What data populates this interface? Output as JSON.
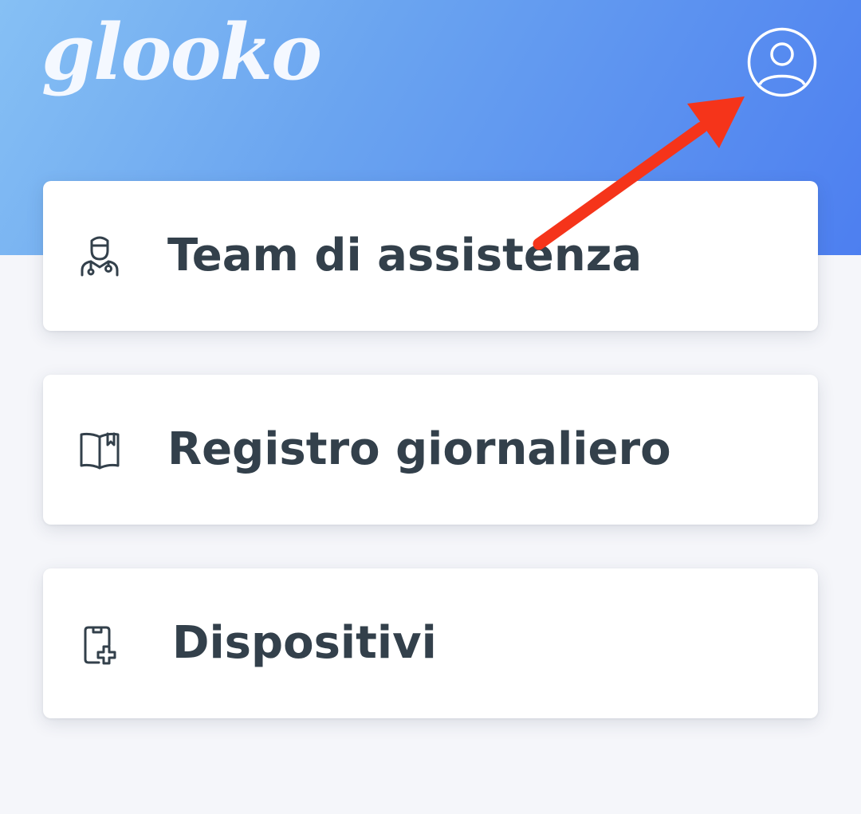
{
  "app": {
    "logo_text": "glooko"
  },
  "header": {
    "profile_icon": "user-circle-icon",
    "colors": {
      "gradient_start": "#86c0f4",
      "gradient_end": "#4d7ff0"
    }
  },
  "menu": {
    "items": [
      {
        "label": "Team di assistenza",
        "icon": "doctor-icon"
      },
      {
        "label": "Registro giornaliero",
        "icon": "logbook-icon"
      },
      {
        "label": "Dispositivi",
        "icon": "device-add-icon"
      }
    ]
  },
  "annotation": {
    "arrow_color": "#f5341a"
  }
}
